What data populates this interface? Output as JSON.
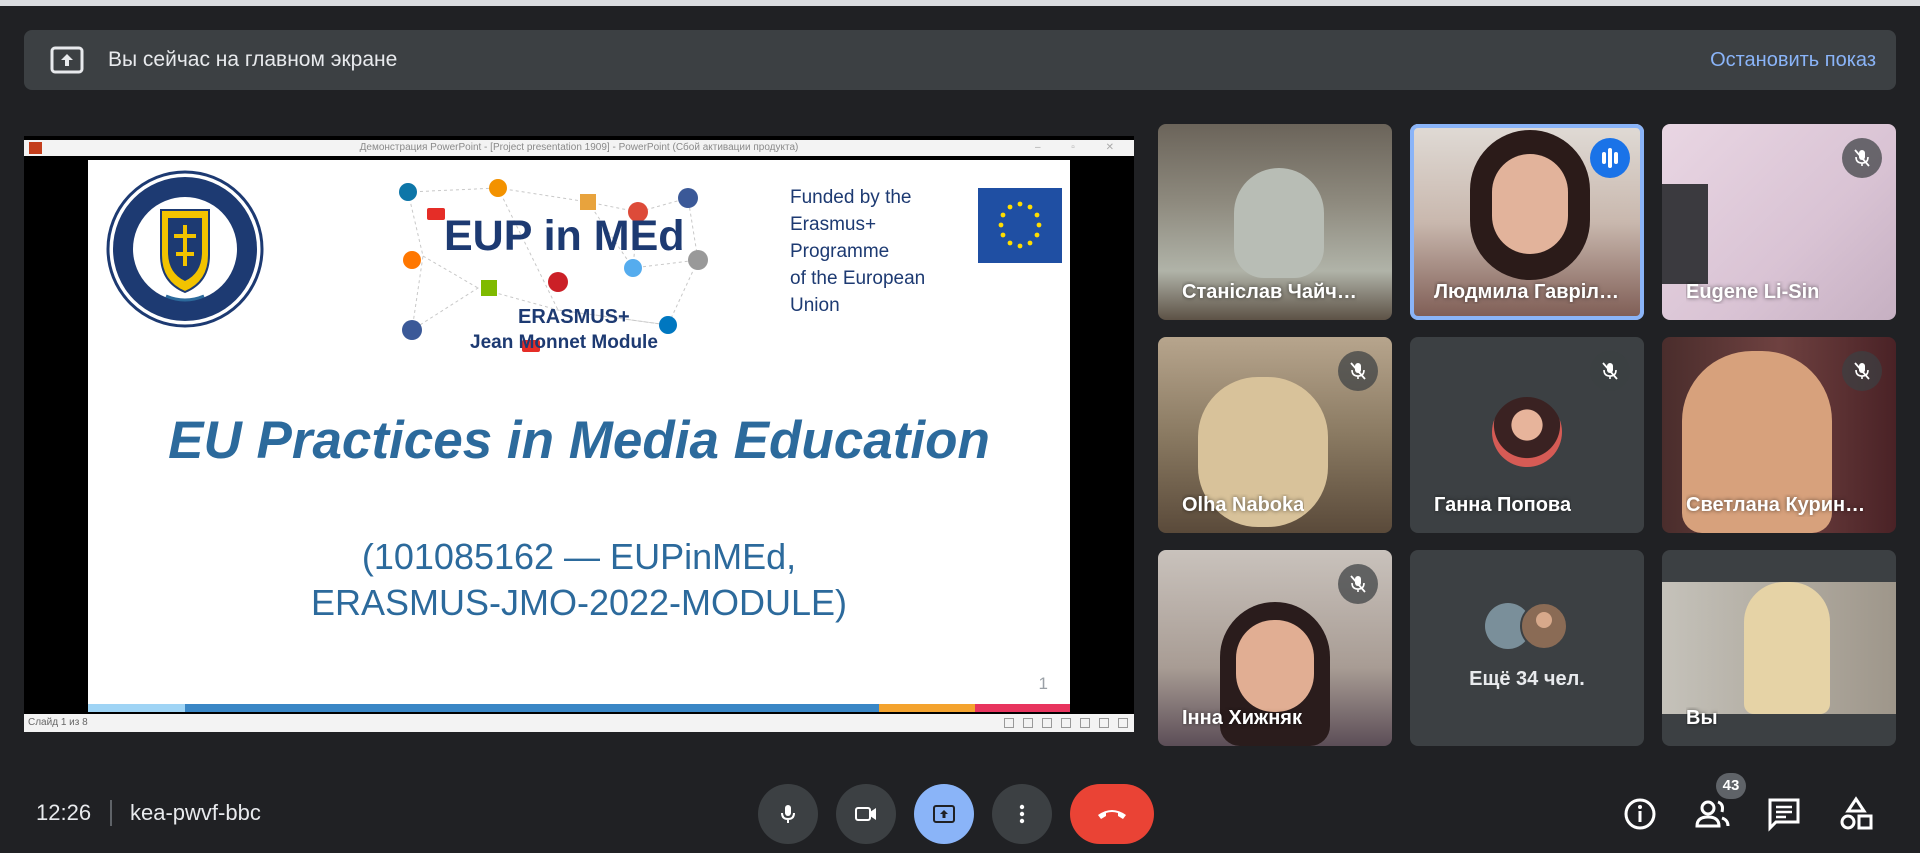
{
  "banner": {
    "text": "Вы сейчас на главном экране",
    "stop_label": "Остановить показ"
  },
  "presentation": {
    "window_title": "Демонстрация PowerPoint - [Project presentation 1909] - PowerPoint (Сбой активации продукта)",
    "status_left": "Слайд 1 из 8",
    "slide": {
      "logo_title": "EUP in MEd",
      "erasmus": "ERASMUS+",
      "module": "Jean Monnet Module",
      "funded_lines": [
        "Funded by the",
        "Erasmus+ Programme",
        "of the European Union"
      ],
      "title": "EU Practices in Media Education",
      "subtitle_lines": [
        "(101085162 — EUPinMEd,",
        "ERASMUS-JMO-2022-MODULE)"
      ],
      "page_number": "1",
      "seal_text": "ДОНБАСЬКИЙ ДЕРЖАВНИЙ ПЕДАГОГІЧНИЙ УНІВЕРСИТЕТ",
      "seal_motto": "Docere Est Discere",
      "seal_year": "1939",
      "social_icons": [
        "linkedin",
        "rss",
        "windows",
        "google-plus",
        "facebook",
        "youtube",
        "soundcloud",
        "pinterest",
        "twitter",
        "apple",
        "drupal"
      ]
    }
  },
  "participants": [
    {
      "name": "Станіслав Чайч…",
      "muted": false
    },
    {
      "name": "Людмила Гавріл…",
      "speaking": true
    },
    {
      "name": "Eugene Li-Sin",
      "muted": true
    },
    {
      "name": "Olha Naboka",
      "muted": true
    },
    {
      "name": "Ганна Попова",
      "muted": true
    },
    {
      "name": "Светлана Курин…",
      "muted": true
    },
    {
      "name": "Інна Хижняк",
      "muted": true
    },
    {
      "name": "Ещё 34 чел."
    },
    {
      "name": "Вы"
    }
  ],
  "bottom": {
    "time": "12:26",
    "meeting_code": "kea-pwvf-bbc",
    "people_count": "43"
  },
  "colors": {
    "background": "#202124",
    "accent": "#8ab4f8",
    "hangup": "#ea4335",
    "speaking": "#1a73e8"
  },
  "icons": [
    "present-screen-icon",
    "mic-icon",
    "camera-icon",
    "present-icon",
    "more-vert-icon",
    "hangup-icon",
    "info-icon",
    "people-icon",
    "chat-icon",
    "activities-icon",
    "mic-off-icon"
  ]
}
